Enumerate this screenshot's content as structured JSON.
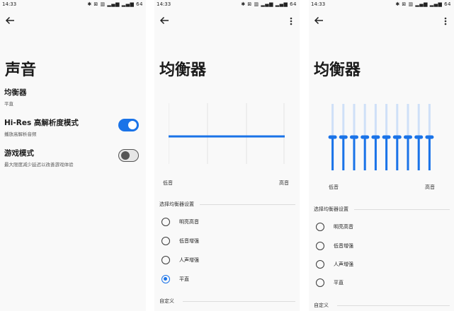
{
  "status_bar": {
    "time": "14:33",
    "icons": "✱ ⊠ ▥ ▂▄▆ ▂▄▆ 64"
  },
  "sound_screen": {
    "title": "声音",
    "equalizer": {
      "label": "均衡器",
      "value": "平直"
    },
    "hires": {
      "label": "Hi-Res 高解析度模式",
      "desc": "播放高解析音频",
      "enabled": true
    },
    "game_mode": {
      "label": "游戏模式",
      "desc": "最大限度减少延迟以改善游戏体验",
      "enabled": false
    }
  },
  "eq_screen_flat": {
    "title": "均衡器",
    "low_label": "低音",
    "high_label": "高音",
    "section_label": "选择均衡器设置",
    "presets": [
      {
        "label": "明亮高音",
        "selected": false
      },
      {
        "label": "低音增强",
        "selected": false
      },
      {
        "label": "人声增强",
        "selected": false
      },
      {
        "label": "平直",
        "selected": true
      }
    ],
    "custom_label": "自定义"
  },
  "eq_screen_custom": {
    "title": "均衡器",
    "low_label": "低音",
    "high_label": "高音",
    "section_label": "选择均衡器设置",
    "presets": [
      {
        "label": "明亮高音",
        "selected": false
      },
      {
        "label": "低音增强",
        "selected": false
      },
      {
        "label": "人声增强",
        "selected": false
      },
      {
        "label": "平直",
        "selected": false
      }
    ],
    "custom_label": "自定义",
    "band_count": 10,
    "band_levels": [
      0.5,
      0.5,
      0.5,
      0.5,
      0.5,
      0.5,
      0.5,
      0.5,
      0.5,
      0.5
    ]
  },
  "colors": {
    "accent": "#1a73e8",
    "accent_light": "#cfe0f8"
  }
}
